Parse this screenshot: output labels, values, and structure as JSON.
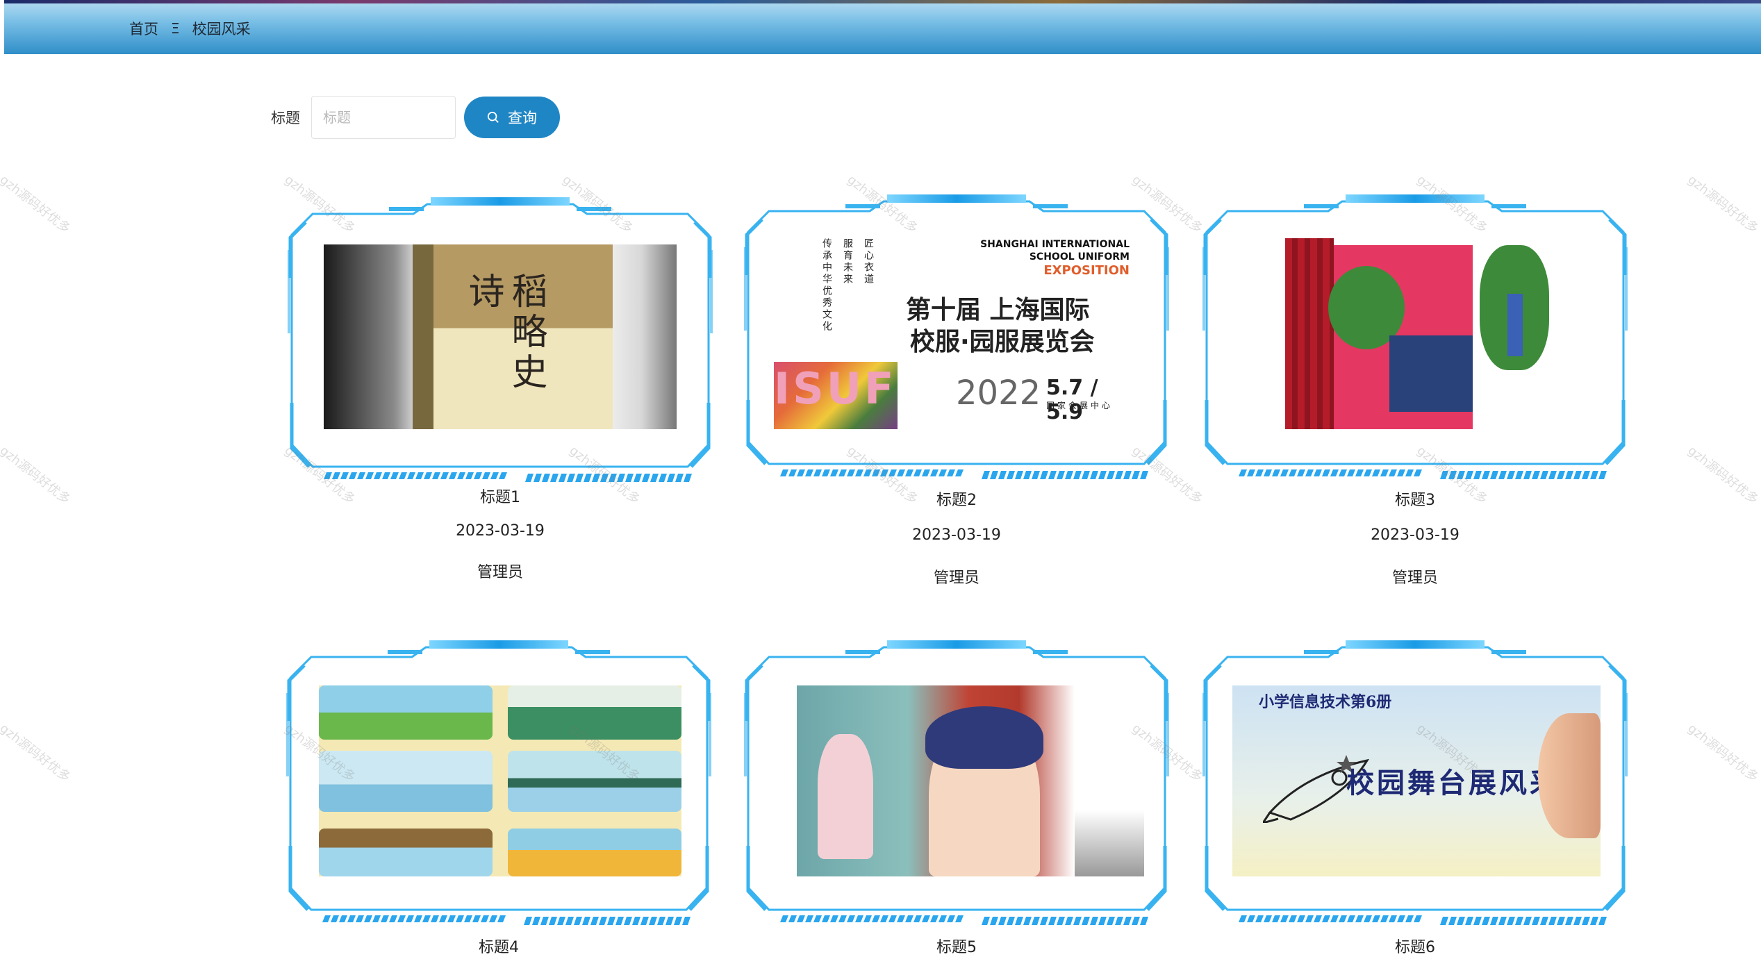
{
  "breadcrumb": {
    "home": "首页",
    "separator": "Ξ",
    "current": "校园风采"
  },
  "search": {
    "label": "标题",
    "placeholder": "标题",
    "value": "",
    "button_label": "查询"
  },
  "cards": [
    {
      "title": "标题1",
      "date": "2023-03-19",
      "author": "管理员",
      "image": {
        "book_title": "稻略史诗"
      }
    },
    {
      "title": "标题2",
      "date": "2023-03-19",
      "author": "管理员",
      "image": {
        "vert_1": "传承中华优秀文化",
        "vert_2": "服育未来",
        "vert_3": "匠心衣道",
        "english_1": "SHANGHAI INTERNATIONAL",
        "english_2": "SCHOOL UNIFORM",
        "english_3": "EXPOSITION",
        "line1": "第十届 上海国际",
        "line2": "校服·园服展览会",
        "year": "2022",
        "dates": "5.7 / 5.9",
        "venue": "国家会展中心",
        "logo": "ISUF"
      }
    },
    {
      "title": "标题3",
      "date": "2023-03-19",
      "author": "管理员",
      "image": {}
    },
    {
      "title": "标题4",
      "date": "",
      "author": "",
      "image": {}
    },
    {
      "title": "标题5",
      "date": "",
      "author": "",
      "image": {}
    },
    {
      "title": "标题6",
      "date": "",
      "author": "",
      "image": {
        "subtitle": "小学信息技术第6册",
        "headline": "校园舞台展风采"
      }
    }
  ],
  "watermark_text": "gzh源码好优多",
  "colors": {
    "accent": "#1f86c5",
    "frame": "#38b3f0",
    "header_top": "#b6dcf1",
    "header_bottom": "#2f8ec8"
  }
}
